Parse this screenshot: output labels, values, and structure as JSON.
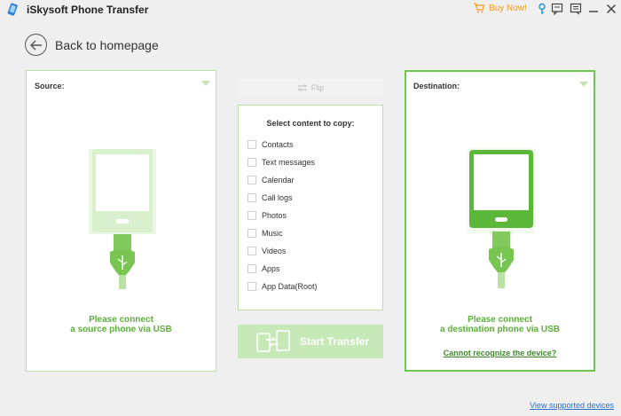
{
  "app": {
    "title": "iSkysoft Phone Transfer"
  },
  "titlebar": {
    "buy_now": "Buy Now!"
  },
  "back": {
    "label": "Back to homepage"
  },
  "source": {
    "label": "Source:",
    "connect_line1": "Please connect",
    "connect_line2": "a source phone via USB"
  },
  "flip": {
    "label": "Flip"
  },
  "content": {
    "title": "Select content to copy:",
    "items": [
      "Contacts",
      "Text messages",
      "Calendar",
      "Call logs",
      "Photos",
      "Music",
      "Videos",
      "Apps",
      "App Data(Root)"
    ]
  },
  "start": {
    "label": "Start Transfer"
  },
  "destination": {
    "label": "Destination:",
    "connect_line1": "Please connect",
    "connect_line2": "a destination phone via USB",
    "cannot_recognize": "Cannot recognize the device?"
  },
  "footer": {
    "view_supported": "View supported devices"
  },
  "colors": {
    "green": "#6ec84f",
    "light_green": "#c7e9b8",
    "accent_orange": "#f39a1e",
    "link_blue": "#2a6fd0"
  }
}
